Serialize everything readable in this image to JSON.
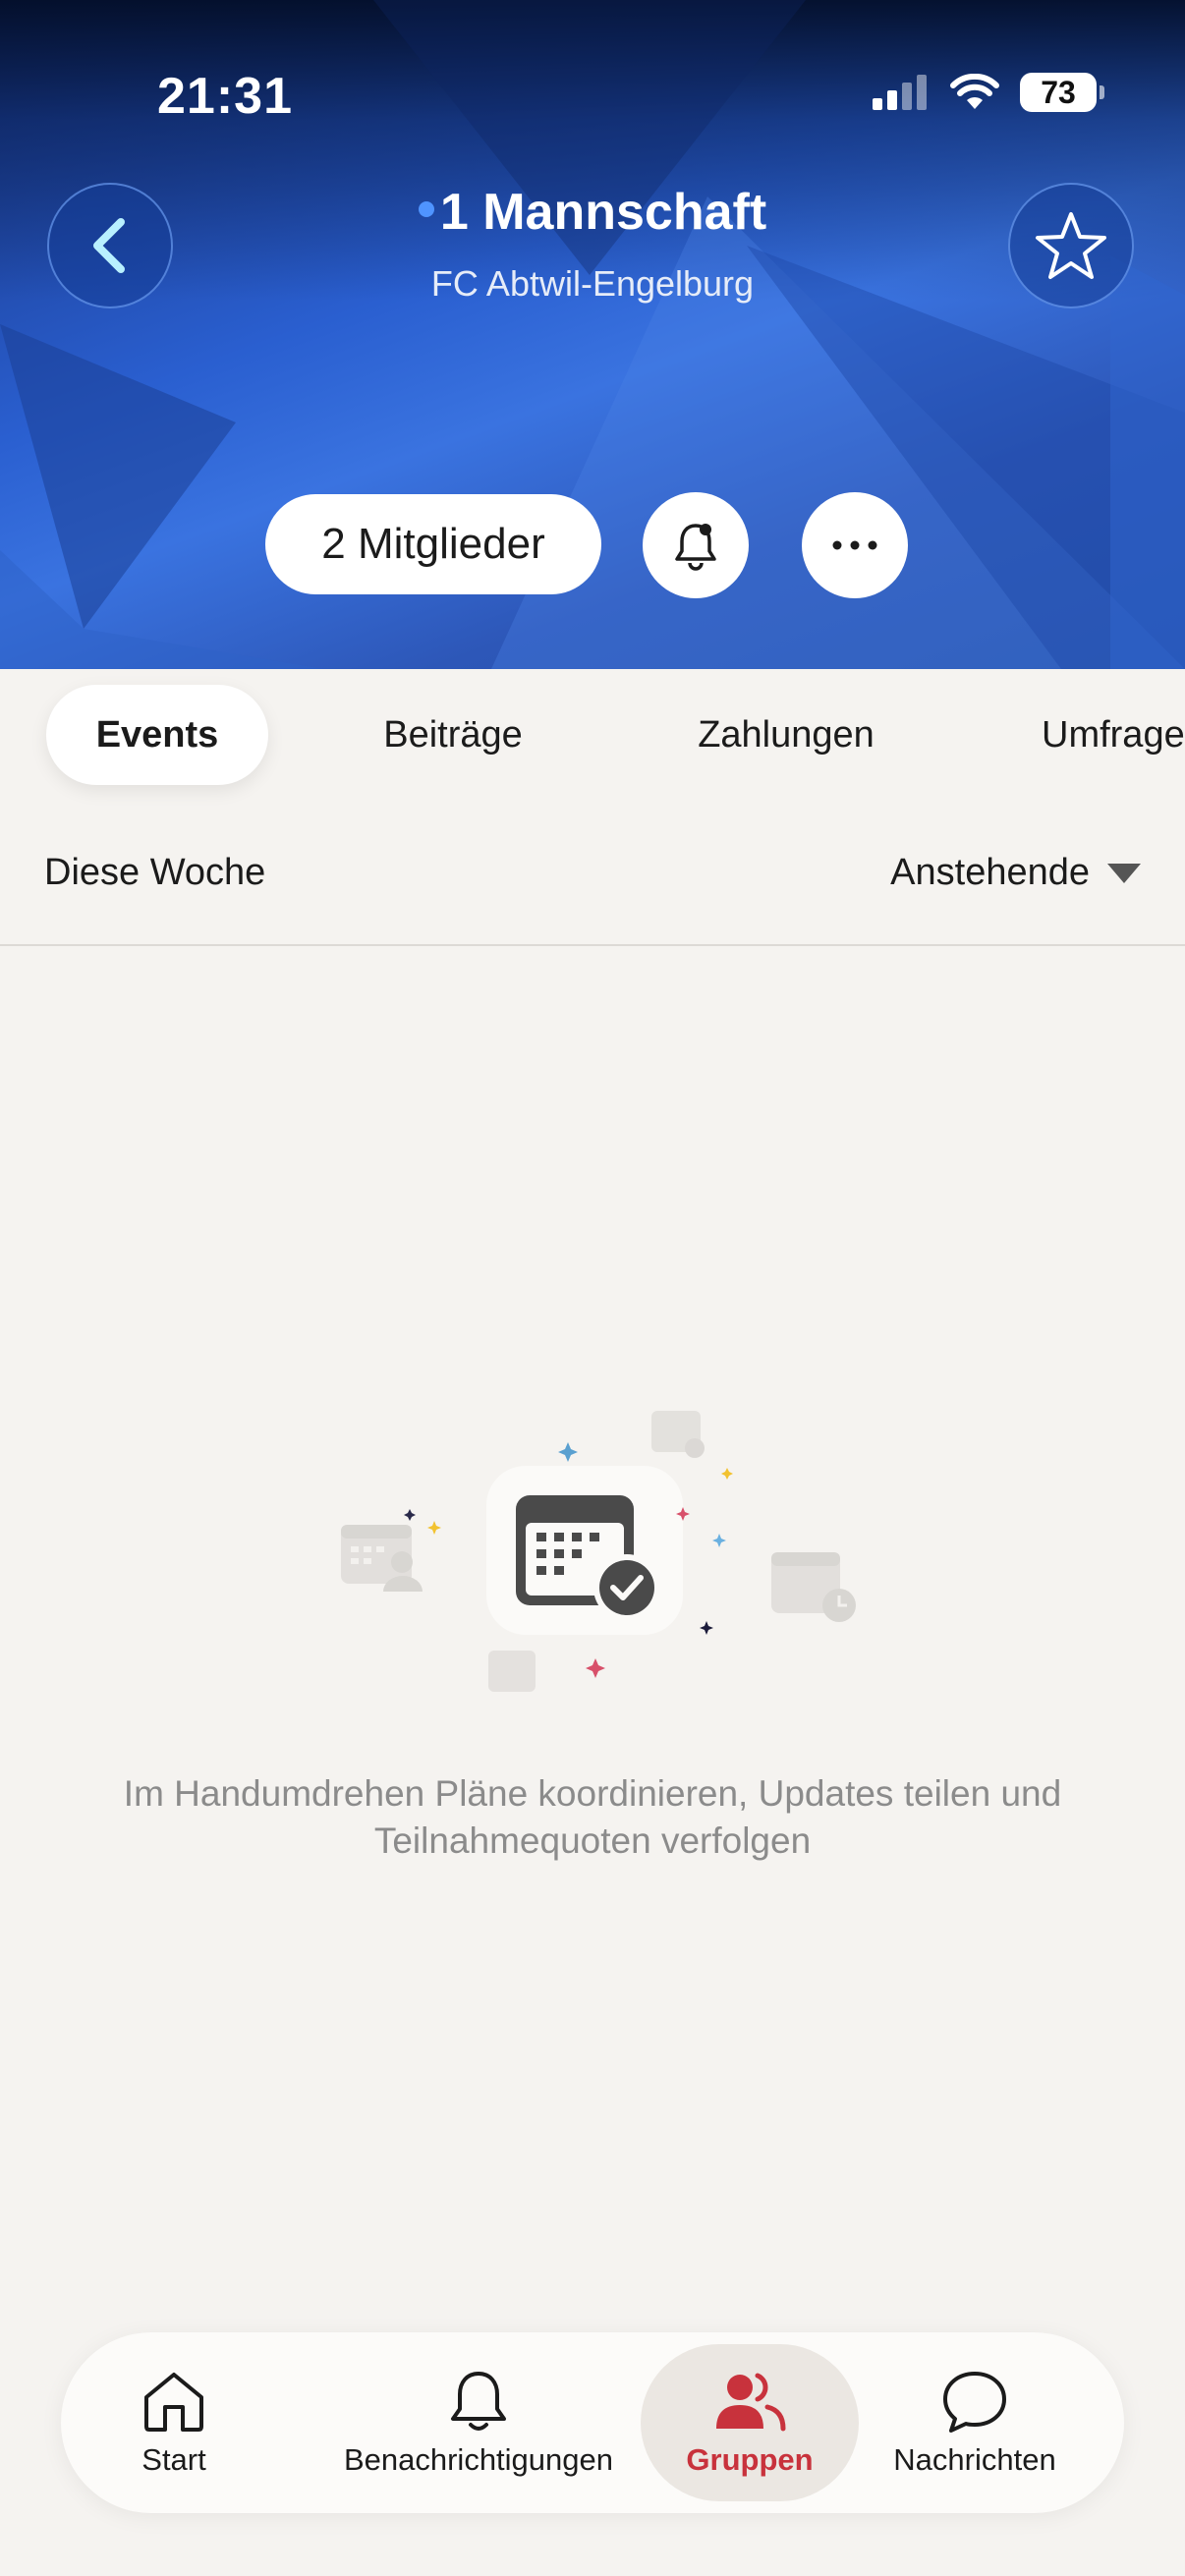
{
  "status_bar": {
    "time": "21:31",
    "battery": "73"
  },
  "header": {
    "title": "1 Mannschaft",
    "subtitle": "FC Abtwil-Engelburg",
    "members_button": "2 Mitglieder",
    "back_icon": "chevron-left-icon",
    "favorite_icon": "star-icon",
    "bell_icon": "bell-icon",
    "more_icon": "more-horizontal-icon"
  },
  "tabs": [
    {
      "label": "Events",
      "active": true
    },
    {
      "label": "Beiträge",
      "active": false
    },
    {
      "label": "Zahlungen",
      "active": false
    },
    {
      "label": "Umfrage",
      "active": false
    }
  ],
  "filter": {
    "period": "Diese Woche",
    "status": "Anstehende"
  },
  "empty_state": {
    "text": "Im Handumdrehen Pläne koordinieren, Updates teilen und Teilnahmequoten verfolgen"
  },
  "bottom_nav": [
    {
      "label": "Start",
      "icon": "home-icon",
      "active": false
    },
    {
      "label": "Benachrichtigungen",
      "icon": "bell-icon",
      "active": false
    },
    {
      "label": "Gruppen",
      "icon": "group-icon",
      "active": true
    },
    {
      "label": "Nachrichten",
      "icon": "chat-bubble-icon",
      "active": false
    }
  ],
  "colors": {
    "accent_active": "#c8323c",
    "header_blue": "#2a5fd0"
  }
}
